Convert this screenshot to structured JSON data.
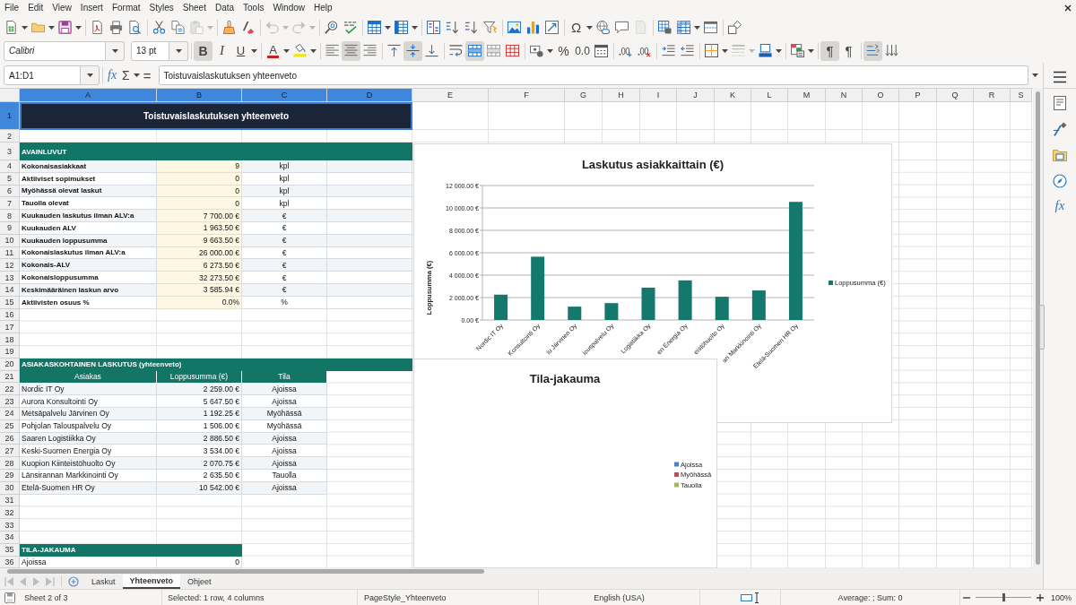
{
  "menu_bar": [
    "File",
    "Edit",
    "View",
    "Insert",
    "Format",
    "Styles",
    "Sheet",
    "Data",
    "Tools",
    "Window",
    "Help"
  ],
  "standard_toolbar": [
    [
      {
        "kind": "new",
        "disabled": false
      },
      {
        "kind": "caret",
        "disabled": false
      },
      {
        "kind": "open",
        "disabled": false
      },
      {
        "kind": "caret",
        "disabled": false
      },
      {
        "kind": "save",
        "disabled": false
      },
      {
        "kind": "caret",
        "disabled": false
      }
    ],
    [
      {
        "kind": "pdf",
        "disabled": false
      },
      {
        "kind": "print",
        "disabled": false
      },
      {
        "kind": "preview",
        "disabled": false
      }
    ],
    [
      {
        "kind": "cut",
        "disabled": false
      },
      {
        "kind": "copy",
        "disabled": false
      },
      {
        "kind": "paste",
        "disabled": true
      },
      {
        "kind": "caret",
        "disabled": true
      }
    ],
    [
      {
        "kind": "clone",
        "disabled": false
      },
      {
        "kind": "clear",
        "disabled": false
      }
    ],
    [
      {
        "kind": "undo",
        "disabled": true
      },
      {
        "kind": "caret",
        "disabled": true
      },
      {
        "kind": "redo",
        "disabled": true
      },
      {
        "kind": "caret",
        "disabled": true
      }
    ],
    [
      {
        "kind": "find",
        "disabled": false
      },
      {
        "kind": "spelling",
        "disabled": false
      }
    ],
    [
      {
        "kind": "rows",
        "disabled": false
      },
      {
        "kind": "caret",
        "disabled": false
      },
      {
        "kind": "columns",
        "disabled": false
      },
      {
        "kind": "caret",
        "disabled": false
      }
    ],
    [
      {
        "kind": "sort",
        "disabled": false
      },
      {
        "kind": "sort_ascending",
        "disabled": false
      },
      {
        "kind": "sort_descending",
        "disabled": false
      },
      {
        "kind": "autofilter",
        "disabled": false
      }
    ],
    [
      {
        "kind": "image",
        "disabled": false
      },
      {
        "kind": "chart",
        "disabled": false
      },
      {
        "kind": "pivot",
        "disabled": false
      }
    ],
    [
      {
        "kind": "special_character",
        "label": "Ω",
        "disabled": false
      },
      {
        "kind": "caret",
        "disabled": false
      },
      {
        "kind": "hyperlink",
        "disabled": false
      },
      {
        "kind": "comment",
        "disabled": false
      },
      {
        "kind": "header_footer",
        "disabled": true
      }
    ],
    [
      {
        "kind": "print_area",
        "disabled": false
      },
      {
        "kind": "freeze",
        "disabled": false
      },
      {
        "kind": "caret",
        "disabled": false
      },
      {
        "kind": "split",
        "disabled": false
      }
    ],
    [
      {
        "kind": "draw",
        "disabled": false
      }
    ]
  ],
  "formatting_toolbar": {
    "font_name": "Calibri",
    "font_size": "13 pt",
    "groups": [
      [
        {
          "kind": "bold",
          "label": "B",
          "pressed": true,
          "disabled": false
        },
        {
          "kind": "italic",
          "label": "I",
          "pressed": false,
          "disabled": false
        },
        {
          "kind": "underline",
          "label": "U",
          "pressed": false,
          "disabled": false
        },
        {
          "kind": "caret",
          "pressed": false,
          "disabled": false
        }
      ],
      [
        {
          "kind": "font_color",
          "label": "A",
          "pressed": false,
          "disabled": false
        },
        {
          "kind": "caret",
          "pressed": false,
          "disabled": false
        },
        {
          "kind": "highlight",
          "pressed": false,
          "disabled": false
        },
        {
          "kind": "caret",
          "pressed": false,
          "disabled": false
        }
      ],
      [
        {
          "kind": "align_left",
          "pressed": false,
          "disabled": false
        },
        {
          "kind": "align_center",
          "pressed": true,
          "disabled": false
        },
        {
          "kind": "align_right",
          "pressed": false,
          "disabled": false
        }
      ],
      [
        {
          "kind": "align_top",
          "pressed": false,
          "disabled": false
        },
        {
          "kind": "align_middle",
          "pressed": true,
          "disabled": false
        },
        {
          "kind": "align_bottom",
          "pressed": false,
          "disabled": false
        }
      ],
      [
        {
          "kind": "wrap",
          "pressed": false,
          "disabled": false
        },
        {
          "kind": "merge_center",
          "pressed": true,
          "disabled": false
        },
        {
          "kind": "merge",
          "pressed": false,
          "disabled": false
        },
        {
          "kind": "unmerge",
          "pressed": false,
          "disabled": false
        }
      ],
      [
        {
          "kind": "currency",
          "pressed": false,
          "disabled": false
        },
        {
          "kind": "caret",
          "pressed": false,
          "disabled": false
        },
        {
          "kind": "percent",
          "label": "%",
          "pressed": false,
          "disabled": false
        },
        {
          "kind": "number",
          "label": "0.0",
          "pressed": false,
          "disabled": false
        },
        {
          "kind": "date",
          "pressed": false,
          "disabled": false
        }
      ],
      [
        {
          "kind": "add_decimal",
          "pressed": false,
          "disabled": false
        },
        {
          "kind": "delete_decimal",
          "pressed": false,
          "disabled": false
        }
      ],
      [
        {
          "kind": "indent",
          "pressed": false,
          "disabled": false
        },
        {
          "kind": "outdent",
          "pressed": false,
          "disabled": false
        }
      ],
      [
        {
          "kind": "borders",
          "pressed": false,
          "disabled": false
        },
        {
          "kind": "caret",
          "pressed": false,
          "disabled": false
        },
        {
          "kind": "border_style",
          "pressed": false,
          "disabled": true
        },
        {
          "kind": "caret",
          "pressed": false,
          "disabled": true
        },
        {
          "kind": "border_color",
          "pressed": false,
          "disabled": false
        },
        {
          "kind": "caret",
          "pressed": false,
          "disabled": false
        }
      ],
      [
        {
          "kind": "conditional",
          "pressed": false,
          "disabled": false
        },
        {
          "kind": "caret",
          "pressed": false,
          "disabled": false
        }
      ],
      [
        {
          "kind": "ltr",
          "label": "¶",
          "pressed": true,
          "disabled": false
        },
        {
          "kind": "rtl",
          "label": "¶",
          "pressed": false,
          "disabled": false
        }
      ],
      [
        {
          "kind": "text_horizontal",
          "pressed": true,
          "disabled": false
        },
        {
          "kind": "text_vertical",
          "pressed": false,
          "disabled": false
        }
      ]
    ]
  },
  "formula_bar": {
    "name_box": "A1:D1",
    "function_wizard": "fx",
    "sum": "Σ",
    "formula": "=",
    "content": "Toistuvaislaskutuksen yhteenveto"
  },
  "sidebar": {
    "functions": "fx"
  },
  "sheet": {
    "columns": [
      {
        "label": "A",
        "selected": true
      },
      {
        "label": "B",
        "selected": true
      },
      {
        "label": "C",
        "selected": true
      },
      {
        "label": "D",
        "selected": true
      },
      {
        "label": "E",
        "selected": false
      },
      {
        "label": "F",
        "selected": false
      },
      {
        "label": "G",
        "selected": false
      },
      {
        "label": "H",
        "selected": false
      },
      {
        "label": "I",
        "selected": false
      },
      {
        "label": "J",
        "selected": false
      },
      {
        "label": "K",
        "selected": false
      },
      {
        "label": "L",
        "selected": false
      },
      {
        "label": "M",
        "selected": false
      },
      {
        "label": "N",
        "selected": false
      },
      {
        "label": "O",
        "selected": false
      },
      {
        "label": "P",
        "selected": false
      },
      {
        "label": "Q",
        "selected": false
      },
      {
        "label": "R",
        "selected": false
      },
      {
        "label": "S",
        "selected": false
      }
    ],
    "rows": [
      {
        "label": "1",
        "selected": true
      },
      {
        "label": "2",
        "selected": false
      },
      {
        "label": "3",
        "selected": false
      },
      {
        "label": "4",
        "selected": false
      },
      {
        "label": "5",
        "selected": false
      },
      {
        "label": "6",
        "selected": false
      },
      {
        "label": "7",
        "selected": false
      },
      {
        "label": "8",
        "selected": false
      },
      {
        "label": "9",
        "selected": false
      },
      {
        "label": "10",
        "selected": false
      },
      {
        "label": "11",
        "selected": false
      },
      {
        "label": "12",
        "selected": false
      },
      {
        "label": "13",
        "selected": false
      },
      {
        "label": "14",
        "selected": false
      },
      {
        "label": "15",
        "selected": false
      },
      {
        "label": "16",
        "selected": false
      },
      {
        "label": "17",
        "selected": false
      },
      {
        "label": "18",
        "selected": false
      },
      {
        "label": "19",
        "selected": false
      },
      {
        "label": "20",
        "selected": false
      },
      {
        "label": "21",
        "selected": false
      },
      {
        "label": "22",
        "selected": false
      },
      {
        "label": "23",
        "selected": false
      },
      {
        "label": "24",
        "selected": false
      },
      {
        "label": "25",
        "selected": false
      },
      {
        "label": "26",
        "selected": false
      },
      {
        "label": "27",
        "selected": false
      },
      {
        "label": "28",
        "selected": false
      },
      {
        "label": "29",
        "selected": false
      },
      {
        "label": "30",
        "selected": false
      },
      {
        "label": "31",
        "selected": false
      },
      {
        "label": "32",
        "selected": false
      },
      {
        "label": "33",
        "selected": false
      },
      {
        "label": "34",
        "selected": false
      },
      {
        "label": "35",
        "selected": false
      },
      {
        "label": "36",
        "selected": false
      }
    ]
  },
  "title_cell": {
    "text": "Toistuvaislaskutuksen yhteenveto",
    "selected": true
  },
  "key_figures": {
    "heading": "AVAINLUVUT",
    "rows": [
      {
        "label": "Kokonaisasiakkaat",
        "value": "9",
        "unit": "kpl"
      },
      {
        "label": "Aktiiviset sopimukset",
        "value": "0",
        "unit": "kpl"
      },
      {
        "label": "Myöhässä olevat laskut",
        "value": "0",
        "unit": "kpl"
      },
      {
        "label": "Tauolla olevat",
        "value": "0",
        "unit": "kpl"
      },
      {
        "label": "Kuukauden laskutus ilman ALV:a",
        "value": "7 700.00 €",
        "unit": "€"
      },
      {
        "label": "Kuukauden ALV",
        "value": "1 963.50 €",
        "unit": "€"
      },
      {
        "label": "Kuukauden loppusumma",
        "value": "9 663.50 €",
        "unit": "€"
      },
      {
        "label": "Kokonaislaskutus ilman ALV:a",
        "value": "26 000.00 €",
        "unit": "€"
      },
      {
        "label": "Kokonais-ALV",
        "value": "6 273.50 €",
        "unit": "€"
      },
      {
        "label": "Kokonaisloppusumma",
        "value": "32 273.50 €",
        "unit": "€"
      },
      {
        "label": "Keskimääräinen laskun arvo",
        "value": "3 585.94 €",
        "unit": "€"
      },
      {
        "label": "Aktiivisten osuus %",
        "value": "0.0%",
        "unit": "%"
      }
    ]
  },
  "customer_billing": {
    "heading": "ASIAKASKOHTAINEN LASKUTUS (yhteenveto)",
    "columns": [
      "Asiakas",
      "Loppusumma (€)",
      "Tila"
    ],
    "rows": [
      {
        "customer": "Nordic IT Oy",
        "total": "2 259.00 €",
        "status": "Ajoissa"
      },
      {
        "customer": "Aurora Konsultointi Oy",
        "total": "5 647.50 €",
        "status": "Ajoissa"
      },
      {
        "customer": "Metsäpalvelu Järvinen Oy",
        "total": "1 192.25 €",
        "status": "Myöhässä"
      },
      {
        "customer": "Pohjolan Talouspalvelu Oy",
        "total": "1 506.00 €",
        "status": "Myöhässä"
      },
      {
        "customer": "Saaren Logistiikka Oy",
        "total": "2 886.50 €",
        "status": "Ajoissa"
      },
      {
        "customer": "Keski-Suomen Energia Oy",
        "total": "3 534.00 €",
        "status": "Ajoissa"
      },
      {
        "customer": "Kuopion Kiinteistöhuolto Oy",
        "total": "2 070.75 €",
        "status": "Ajoissa"
      },
      {
        "customer": "Länsirannan Markkinointi Oy",
        "total": "2 635.50 €",
        "status": "Tauolla"
      },
      {
        "customer": "Etelä-Suomen HR Oy",
        "total": "10 542.00 €",
        "status": "Ajoissa"
      }
    ]
  },
  "status_distribution": {
    "heading": "TILA-JAKAUMA",
    "rows": [
      {
        "label": "Ajoissa",
        "value": "0"
      }
    ]
  },
  "bar_chart": {
    "chart_data": {
      "type": "bar",
      "title": "Laskutus asiakkaittain (€)",
      "ylabel": "Loppusumma (€)",
      "categories": [
        "Nordic IT Oy",
        "Konsultointi Oy",
        "lu Järvinen Oy",
        "louspalvelu Oy",
        "Logistiikka Oy",
        "en Energia Oy",
        "eistöhuolto Oy",
        "an Markkinointi Oy",
        "Etelä-Suomen HR Oy"
      ],
      "series": [
        {
          "name": "Loppusumma (€)",
          "color": "#14796c",
          "values": [
            2259,
            5647.5,
            1192.25,
            1506,
            2886.5,
            3534,
            2070.75,
            2635.5,
            10542
          ]
        }
      ],
      "ylim": [
        0,
        12000
      ],
      "yticks": [
        {
          "value": 0,
          "label": "0.00 €"
        },
        {
          "value": 2000,
          "label": "2 000.00 €"
        },
        {
          "value": 4000,
          "label": "4 000.00 €"
        },
        {
          "value": 6000,
          "label": "6 000.00 €"
        },
        {
          "value": 8000,
          "label": "8 000.00 €"
        },
        {
          "value": 10000,
          "label": "10 000.00 €"
        },
        {
          "value": 12000,
          "label": "12 000.00 €"
        }
      ],
      "grid": true
    }
  },
  "pie_chart": {
    "title": "Tila-jakauma",
    "legend": [
      {
        "label": "Ajoissa",
        "color": "#4f81bd"
      },
      {
        "label": "Myöhässä",
        "color": "#c0504d"
      },
      {
        "label": "Tauolla",
        "color": "#9bbb59"
      }
    ]
  },
  "tab_navigation": {
    "disabled": true
  },
  "sheet_tabs": [
    {
      "label": "Laskut",
      "selected": false
    },
    {
      "label": "Yhteenveto",
      "selected": true
    },
    {
      "label": "Ohjeet",
      "selected": false
    }
  ],
  "status_bar": {
    "sheet": "Sheet 2 of 3",
    "selection": "Selected: 1 row, 4 columns",
    "page_style": "PageStyle_Yhteenveto",
    "language": "English (USA)",
    "summary": "Average: ; Sum: 0",
    "zoom_slider": {
      "level": 0.5
    },
    "zoom": "100%"
  }
}
